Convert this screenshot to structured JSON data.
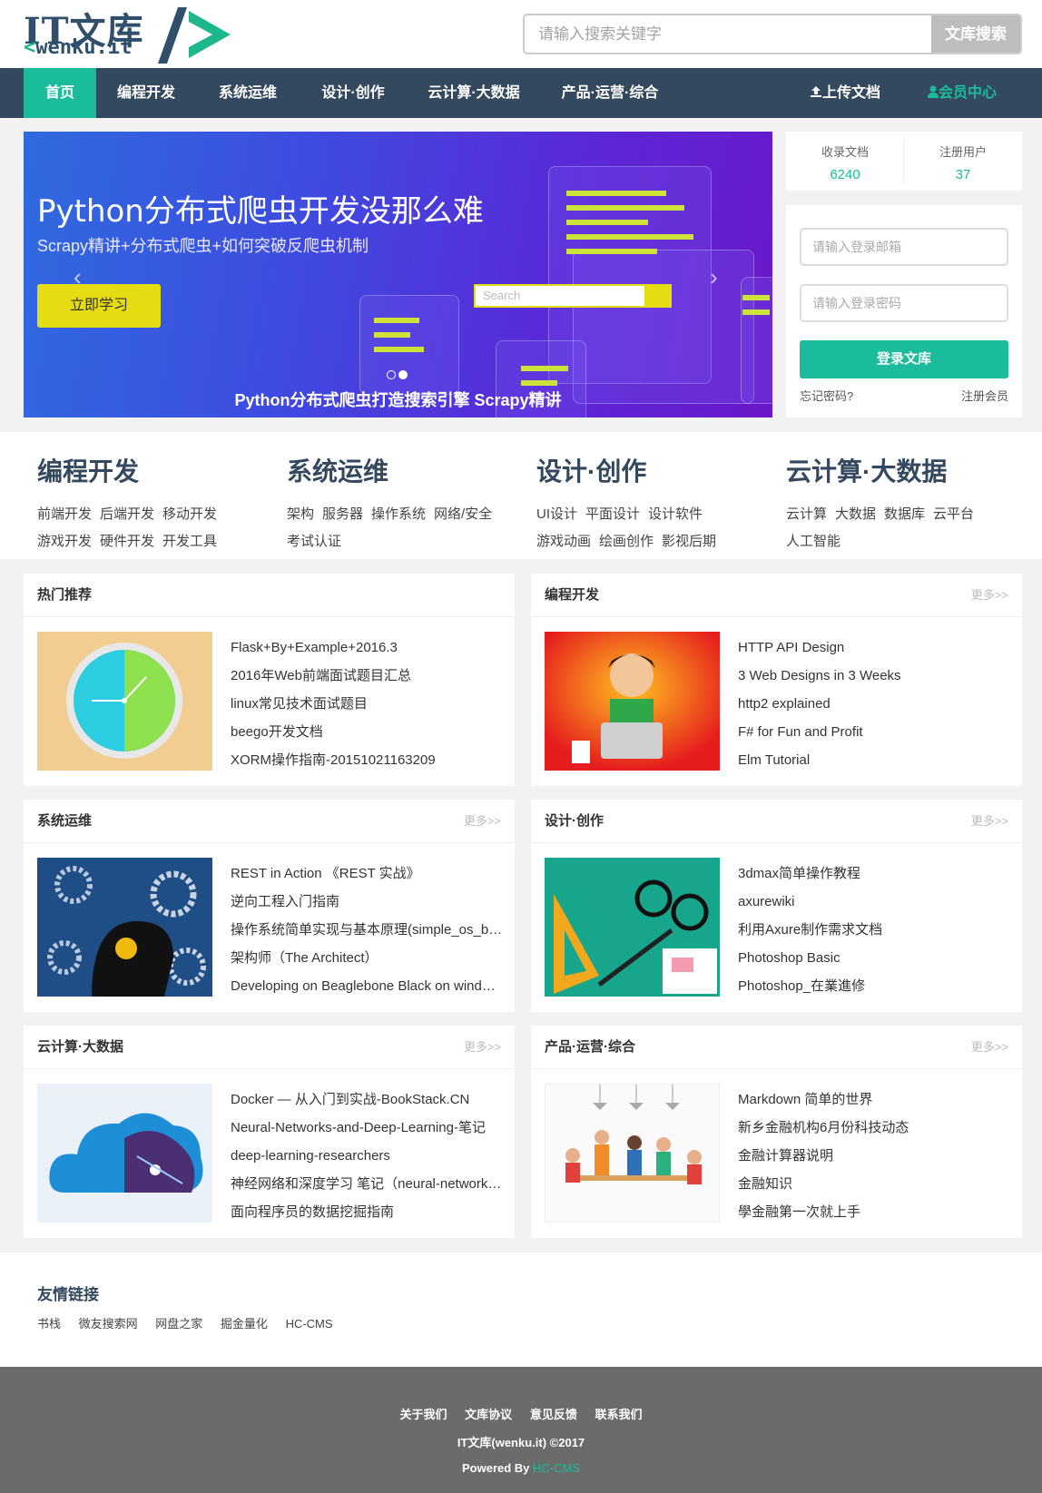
{
  "header": {
    "logo_main": "IT文库",
    "logo_lt": "<",
    "logo_sub": "wenku.it",
    "search_placeholder": "请输入搜索关键字",
    "search_button": "文库搜索"
  },
  "nav": {
    "items": [
      "首页",
      "编程开发",
      "系统运维",
      "设计·创作",
      "云计算·大数据",
      "产品·运营·综合"
    ],
    "upload": "上传文档",
    "member": "会员中心"
  },
  "banner": {
    "title": "Python分布式爬虫开发没那么难",
    "subtitle": "Scrapy精讲+分布式爬虫+如何突破反爬虫机制",
    "button": "立即学习",
    "search_placeholder": "Search",
    "caption": "Python分布式爬虫打造搜索引擎 Scrapy精讲"
  },
  "stats": {
    "docs_label": "收录文档",
    "docs_value": "6240",
    "users_label": "注册用户",
    "users_value": "37"
  },
  "login": {
    "email_placeholder": "请输入登录邮箱",
    "password_placeholder": "请输入登录密码",
    "button": "登录文库",
    "forgot": "忘记密码?",
    "register": "注册会员"
  },
  "categories": [
    {
      "title": "编程开发",
      "links": [
        "前端开发",
        "后端开发",
        "移动开发",
        "游戏开发",
        "硬件开发",
        "开发工具"
      ]
    },
    {
      "title": "系统运维",
      "links": [
        "架构",
        "服务器",
        "操作系统",
        "网络/安全",
        "考试认证"
      ]
    },
    {
      "title": "设计·创作",
      "links": [
        "UI设计",
        "平面设计",
        "设计软件",
        "游戏动画",
        "绘画创作",
        "影视后期"
      ]
    },
    {
      "title": "云计算·大数据",
      "links": [
        "云计算",
        "大数据",
        "数据库",
        "云平台",
        "人工智能"
      ]
    }
  ],
  "panels": [
    {
      "title": "热门推荐",
      "more": "",
      "image": "clock",
      "items": [
        "Flask+By+Example+2016.3",
        "2016年Web前端面试题目汇总",
        "linux常见技术面试题目",
        "beego开发文档",
        "XORM操作指南-20151021163209"
      ]
    },
    {
      "title": "编程开发",
      "more": "更多>>",
      "image": "developer",
      "items": [
        "HTTP API Design",
        "3 Web Designs in 3 Weeks",
        "http2 explained",
        "F# for Fun and Profit",
        "Elm Tutorial"
      ]
    },
    {
      "title": "系统运维",
      "more": "更多>>",
      "image": "gears",
      "items": [
        "REST in Action 《REST 实战》",
        "逆向工程入门指南",
        "操作系统简单实现与基本原理(simple_os_book)",
        "架构师（The Architect）",
        "Developing on Beaglebone Black on windows"
      ]
    },
    {
      "title": "设计·创作",
      "more": "更多>>",
      "image": "design",
      "items": [
        "3dmax简单操作教程",
        "axurewiki",
        "利用Axure制作需求文档",
        "Photoshop Basic",
        "Photoshop_在業進修"
      ]
    },
    {
      "title": "云计算·大数据",
      "more": "更多>>",
      "image": "cloud",
      "items": [
        "Docker — 从入门到实战-BookStack.CN",
        "Neural-Networks-and-Deep-Learning-笔记",
        "deep-learning-researchers",
        "神经网络和深度学习 笔记（neural-networks）",
        "面向程序员的数据挖掘指南"
      ]
    },
    {
      "title": "产品·运营·综合",
      "more": "更多>>",
      "image": "team",
      "items": [
        "Markdown 简单的世界",
        "新乡金融机构6月份科技动态",
        "金融计算器说明",
        "金融知识",
        "學金融第一次就上手"
      ]
    }
  ],
  "friends": {
    "title": "友情链接",
    "links": [
      "书栈",
      "微友搜索网",
      "网盘之家",
      "掘金量化",
      "HC-CMS"
    ]
  },
  "footer": {
    "links": [
      "关于我们",
      "文库协议",
      "意见反馈",
      "联系我们"
    ],
    "copyright": "IT文库(wenku.it) ©2017",
    "powered_label": "Powered By ",
    "powered_name": "HC-CMS"
  },
  "colors": {
    "brand": "#1abc9c",
    "nav": "#34495e",
    "banner_button": "#e6dc12",
    "footer": "#6b6b6b"
  }
}
